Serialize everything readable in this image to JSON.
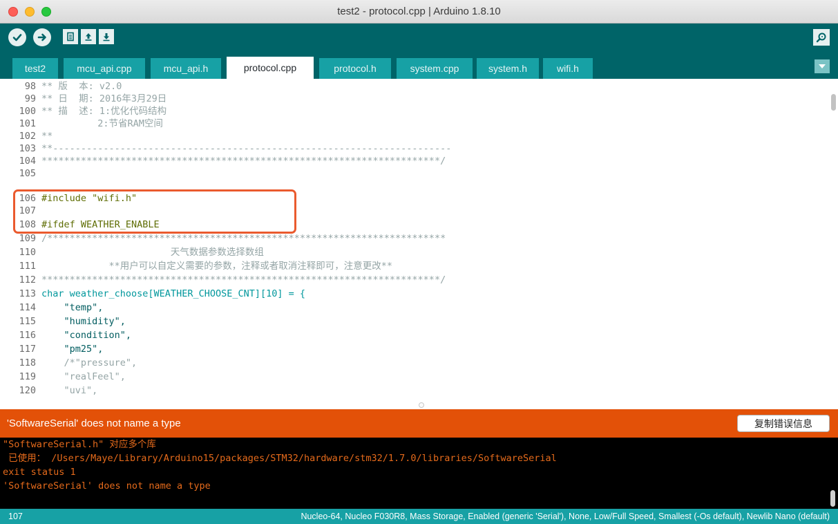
{
  "window": {
    "title": "test2 - protocol.cpp | Arduino 1.8.10"
  },
  "toolbar": {
    "buttons": [
      "verify-icon",
      "upload-icon",
      "new-icon",
      "open-icon",
      "save-icon",
      "serial-monitor-icon"
    ]
  },
  "tabs": [
    {
      "label": "test2",
      "active": false
    },
    {
      "label": "mcu_api.cpp",
      "active": false
    },
    {
      "label": "mcu_api.h",
      "active": false
    },
    {
      "label": "protocol.cpp",
      "active": true
    },
    {
      "label": "protocol.h",
      "active": false
    },
    {
      "label": "system.cpp",
      "active": false
    },
    {
      "label": "system.h",
      "active": false
    },
    {
      "label": "wifi.h",
      "active": false
    }
  ],
  "editor": {
    "lines": [
      {
        "n": "98",
        "text": "** 版  本: v2.0"
      },
      {
        "n": "99",
        "text": "** 日  期: 2016年3月29日"
      },
      {
        "n": "100",
        "text": "** 描  述: 1:优化代码结构"
      },
      {
        "n": "101",
        "text": "          2:节省RAM空间"
      },
      {
        "n": "102",
        "text": "**"
      },
      {
        "n": "103",
        "text": "**-----------------------------------------------------------------------"
      },
      {
        "n": "104",
        "text": "***********************************************************************/"
      },
      {
        "n": "105",
        "text": ""
      },
      {
        "n": "106",
        "text": "#include \"wifi.h\""
      },
      {
        "n": "107",
        "text": ""
      },
      {
        "n": "108",
        "text": "#ifdef WEATHER_ENABLE"
      },
      {
        "n": "109",
        "text": "/***********************************************************************"
      },
      {
        "n": "110",
        "text": "                       天气数据参数选择数组"
      },
      {
        "n": "111",
        "text": "            **用户可以自定义需要的参数，注释或者取消注释即可，注意更改**"
      },
      {
        "n": "112",
        "text": "***********************************************************************/"
      },
      {
        "n": "113",
        "text": "char weather_choose[WEATHER_CHOOSE_CNT][10] = {"
      },
      {
        "n": "114",
        "text": "    \"temp\","
      },
      {
        "n": "115",
        "text": "    \"humidity\","
      },
      {
        "n": "116",
        "text": "    \"condition\","
      },
      {
        "n": "117",
        "text": "    \"pm25\","
      },
      {
        "n": "118",
        "text": "    /*\"pressure\","
      },
      {
        "n": "119",
        "text": "    \"realFeel\","
      },
      {
        "n": "120",
        "text": "    \"uvi\","
      }
    ]
  },
  "error": {
    "message": "'SoftwareSerial' does not name a type",
    "copy_button": "复制错误信息"
  },
  "console": {
    "lines": [
      "\"SoftwareSerial.h\" 对应多个库",
      " 已使用： /Users/Maye/Library/Arduino15/packages/STM32/hardware/stm32/1.7.0/libraries/SoftwareSerial",
      "exit status 1",
      "'SoftwareSerial' does not name a type"
    ]
  },
  "status": {
    "line": "107",
    "board": "Nucleo-64, Nucleo F030R8, Mass Storage, Enabled (generic 'Serial'), None, Low/Full Speed, Smallest (-Os default), Newlib Nano (default)"
  },
  "colors": {
    "toolbar": "#006468",
    "tab": "#17a1a5",
    "error_bar": "#e35108",
    "console_text": "#e56a1b",
    "highlight_box": "#ea5a2e"
  }
}
